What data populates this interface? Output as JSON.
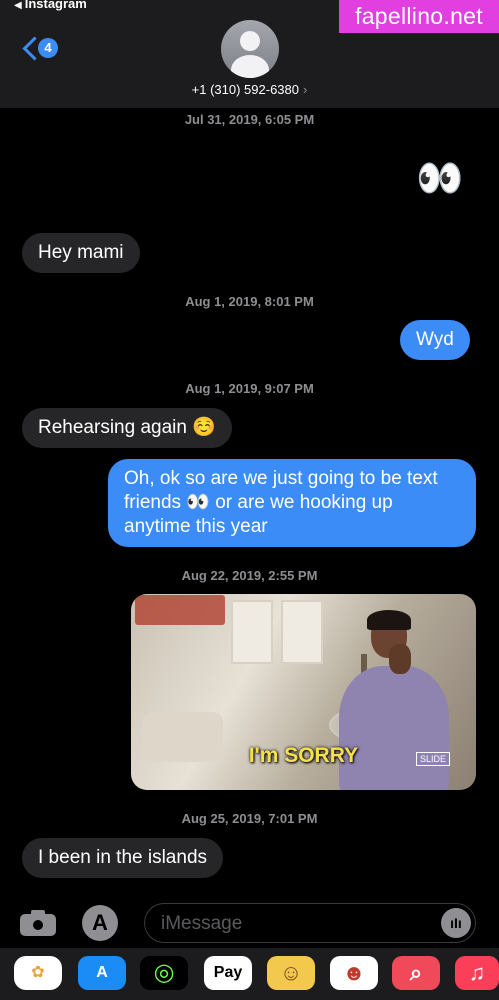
{
  "header": {
    "back_app": "Instagram",
    "back_badge": "4",
    "contact_number": "+1 (310) 592-6380",
    "contact_chevron": "›"
  },
  "watermark": "fapellino.net",
  "messages": {
    "ts1": "Jul 31, 2019, 6:05 PM",
    "eyes1": "👀",
    "m1": "Hey mami",
    "ts2": "Aug 1, 2019, 8:01 PM",
    "m2": "Wyd",
    "ts3": "Aug 1, 2019, 9:07 PM",
    "m3": "Rehearsing again ☺️",
    "m4": "Oh, ok so are we just going to be text friends 👀 or are we hooking up anytime this year",
    "ts4": "Aug 22, 2019, 2:55 PM",
    "gif_caption": "I'm SORRY",
    "gif_logo": "SLIDE",
    "ts5": "Aug 25, 2019, 7:01 PM",
    "m5": "I been in the islands"
  },
  "input": {
    "placeholder": "iMessage",
    "appstore_glyph": "A",
    "audio_glyph": "ıIı"
  },
  "drawer": {
    "applepay_label": "Pay",
    "photos_glyph": "✿",
    "appstore_glyph": "A",
    "activity_glyph": "◎",
    "search_glyph": "⌕",
    "music_glyph": "♫",
    "memoji1_glyph": "☺",
    "memoji2_glyph": "☻",
    "colors": {
      "photos": "#ffffff",
      "appstore": "#1b8cf5",
      "activity": "#000000",
      "applepay": "#ffffff",
      "memoji1": "#f2c94c",
      "memoji2": "#ffffff",
      "search": "#f04a5a",
      "music": "#fb3f58"
    }
  }
}
